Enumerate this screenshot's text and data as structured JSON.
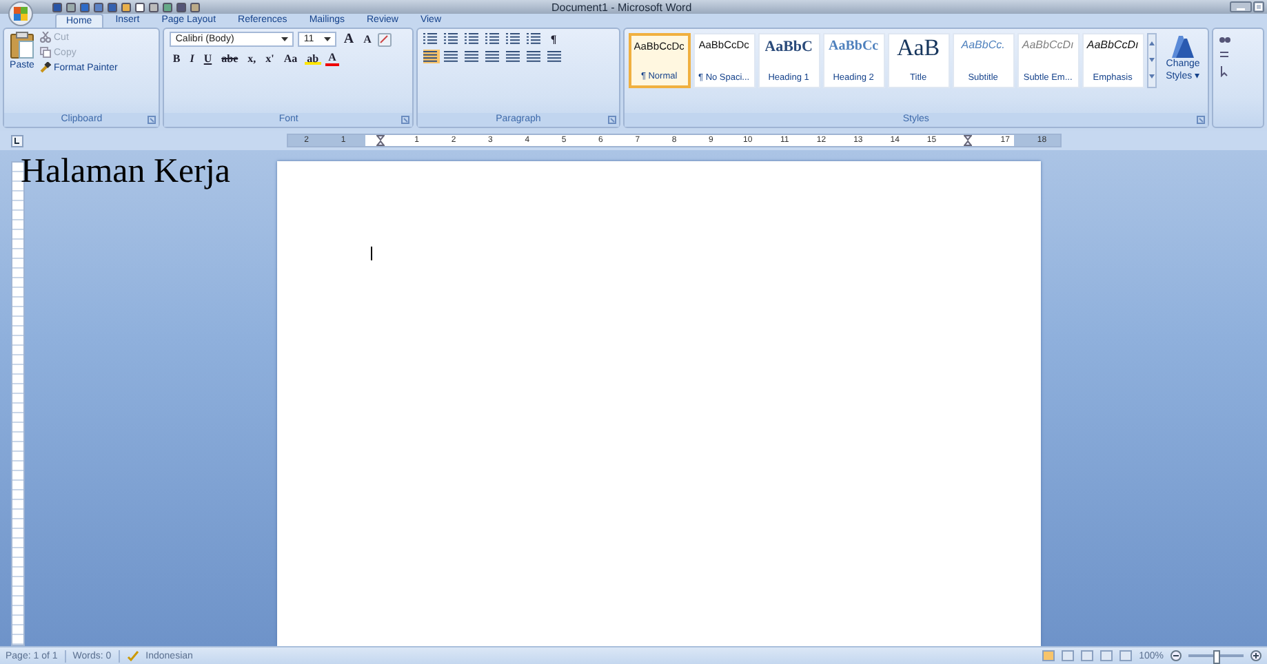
{
  "window": {
    "title": "Document1 - Microsoft Word"
  },
  "tabs": [
    {
      "label": "Home",
      "selected": true
    },
    {
      "label": "Insert",
      "selected": false
    },
    {
      "label": "Page Layout",
      "selected": false
    },
    {
      "label": "References",
      "selected": false
    },
    {
      "label": "Mailings",
      "selected": false
    },
    {
      "label": "Review",
      "selected": false
    },
    {
      "label": "View",
      "selected": false
    }
  ],
  "clipboard": {
    "paste": "Paste",
    "cut": {
      "label": "Cut",
      "disabled": true
    },
    "copy": {
      "label": "Copy",
      "disabled": true
    },
    "format_painter": {
      "label": "Format Painter",
      "disabled": false
    },
    "group_label": "Clipboard"
  },
  "font": {
    "font_name": "Calibri (Body)",
    "font_size": "11",
    "grow": "A",
    "shrink": "A",
    "buttons": [
      "B",
      "I",
      "U",
      "abe",
      "x,",
      "x'",
      "Aa"
    ],
    "highlight": "ab",
    "color_button": "A",
    "group_label": "Font"
  },
  "paragraph": {
    "pilcrow": "¶",
    "group_label": "Paragraph"
  },
  "styles": {
    "items": [
      {
        "preview": "AaBbCcDc",
        "name": "¶ Normal",
        "kind": "normal",
        "selected": true
      },
      {
        "preview": "AaBbCcDc",
        "name": "¶ No Spaci...",
        "kind": "normal",
        "selected": false
      },
      {
        "preview": "AaBbC",
        "name": "Heading 1",
        "kind": "heading1",
        "selected": false
      },
      {
        "preview": "AaBbCc",
        "name": "Heading 2",
        "kind": "heading2",
        "selected": false
      },
      {
        "preview": "AaB",
        "name": "Title",
        "kind": "title",
        "selected": false
      },
      {
        "preview": "AaBbCc.",
        "name": "Subtitle",
        "kind": "subtitle",
        "selected": false
      },
      {
        "preview": "AaBbCcDı",
        "name": "Subtle Em...",
        "kind": "subtle",
        "selected": false
      },
      {
        "preview": "AaBbCcDı",
        "name": "Emphasis",
        "kind": "emphasis",
        "selected": false
      }
    ],
    "change_styles": "Change Styles",
    "change_styles_caret": "▾",
    "group_label": "Styles"
  },
  "ruler": [
    {
      "kind": "number",
      "label": "2"
    },
    {
      "kind": "number",
      "label": "1"
    },
    {
      "kind": "indent-marker"
    },
    {
      "kind": "number",
      "label": "1"
    },
    {
      "kind": "number",
      "label": "2"
    },
    {
      "kind": "number",
      "label": "3"
    },
    {
      "kind": "number",
      "label": "4"
    },
    {
      "kind": "number",
      "label": "5"
    },
    {
      "kind": "number",
      "label": "6"
    },
    {
      "kind": "number",
      "label": "7"
    },
    {
      "kind": "number",
      "label": "8"
    },
    {
      "kind": "number",
      "label": "9"
    },
    {
      "kind": "number",
      "label": "10"
    },
    {
      "kind": "number",
      "label": "11"
    },
    {
      "kind": "number",
      "label": "12"
    },
    {
      "kind": "number",
      "label": "13"
    },
    {
      "kind": "number",
      "label": "14"
    },
    {
      "kind": "number",
      "label": "15"
    },
    {
      "kind": "indent-marker"
    },
    {
      "kind": "number",
      "label": "17"
    },
    {
      "kind": "number",
      "label": "18"
    }
  ],
  "annotation": "Halaman Kerja",
  "status_bar": {
    "page": "Page: 1 of 1",
    "words": "Words: 0",
    "language": "Indonesian",
    "zoom": "100%",
    "zoom_slider": {
      "level": 0.5
    }
  }
}
